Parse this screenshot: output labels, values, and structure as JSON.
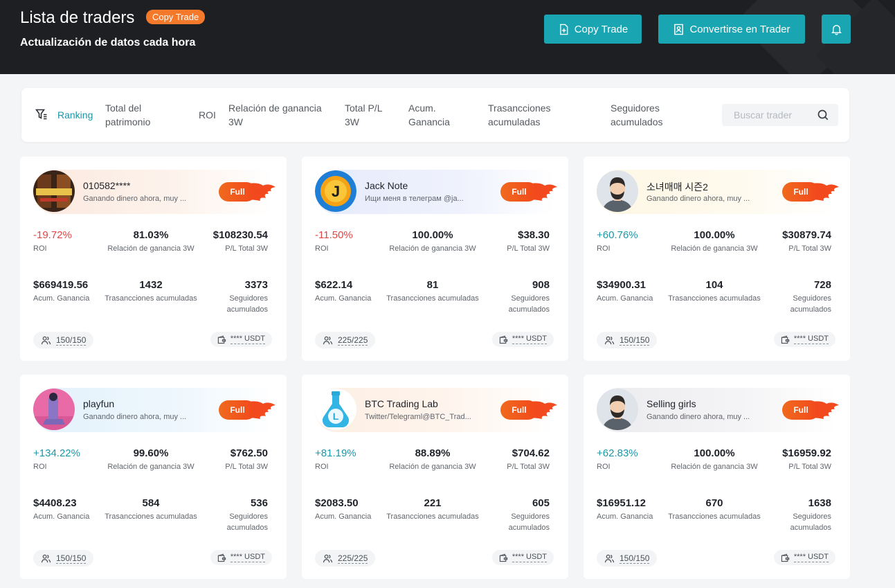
{
  "header": {
    "title": "Lista de traders",
    "badge": "Copy Trade",
    "subtitle": "Actualización de datos cada hora",
    "copy_trade_button": "Copy Trade",
    "become_trader_button": "Convertirse en Trader",
    "bell_icon": "bell-icon"
  },
  "filters": {
    "ranking": "Ranking",
    "items": [
      "Total del patrimonio",
      "ROI",
      "Relación de ganancia 3W",
      "Total P/L 3W",
      "Acum. Ganancia",
      "Trasancciones acumuladas",
      "Seguidores acumulados"
    ],
    "search_placeholder": "Buscar trader"
  },
  "labels": {
    "roi": "ROI",
    "win_ratio": "Relación de ganancia 3W",
    "pl_total": "P/L Total 3W",
    "acum_gain": "Acum. Ganancia",
    "trades": "Trasancciones acumuladas",
    "followers": "Seguidores acumulados",
    "full": "Full"
  },
  "colors": {
    "accent": "#1aa5b3",
    "negative": "#e04444",
    "positive": "#1a97a8",
    "badge": "#f5792a"
  },
  "traders": [
    {
      "name": "010582****",
      "desc": "Ganando dinero ahora, muy ...",
      "roi": "-19.72%",
      "win_ratio": "81.03%",
      "pl_total": "$108230.54",
      "acum_gain": "$669419.56",
      "trades": "1432",
      "followers": "3373",
      "slots": "150/150",
      "usdt": "**** USDT"
    },
    {
      "name": "Jack Note",
      "desc": "Ищи меня в телеграм @ja...",
      "roi": "-11.50%",
      "win_ratio": "100.00%",
      "pl_total": "$38.30",
      "acum_gain": "$622.14",
      "trades": "81",
      "followers": "908",
      "slots": "225/225",
      "usdt": "**** USDT"
    },
    {
      "name": "소녀매매 시즌2",
      "desc": "Ganando dinero ahora, muy ...",
      "roi": "+60.76%",
      "win_ratio": "100.00%",
      "pl_total": "$30879.74",
      "acum_gain": "$34900.31",
      "trades": "104",
      "followers": "728",
      "slots": "150/150",
      "usdt": "**** USDT"
    },
    {
      "name": "playfun",
      "desc": "Ganando dinero ahora, muy ...",
      "roi": "+134.22%",
      "win_ratio": "99.60%",
      "pl_total": "$762.50",
      "acum_gain": "$4408.23",
      "trades": "584",
      "followers": "536",
      "slots": "150/150",
      "usdt": "**** USDT"
    },
    {
      "name": "BTC Trading Lab",
      "desc": "Twitter/Telegraml@BTC_Trad...",
      "roi": "+81.19%",
      "win_ratio": "88.89%",
      "pl_total": "$704.62",
      "acum_gain": "$2083.50",
      "trades": "221",
      "followers": "605",
      "slots": "225/225",
      "usdt": "**** USDT"
    },
    {
      "name": "Selling girls",
      "desc": "Ganando dinero ahora, muy ...",
      "roi": "+62.83%",
      "win_ratio": "100.00%",
      "pl_total": "$16959.92",
      "acum_gain": "$16951.12",
      "trades": "670",
      "followers": "1638",
      "slots": "150/150",
      "usdt": "**** USDT"
    }
  ]
}
